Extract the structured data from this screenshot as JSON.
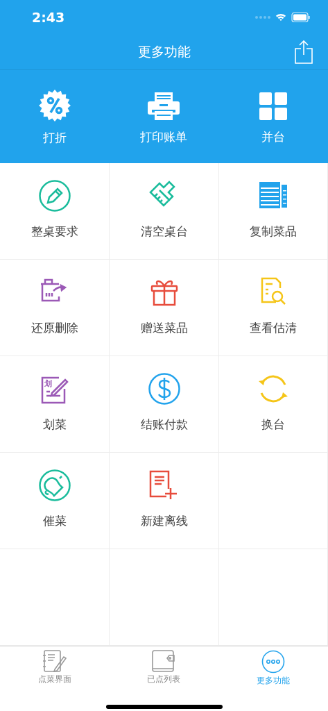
{
  "status_bar": {
    "time": "2:43"
  },
  "nav": {
    "title": "更多功能"
  },
  "quick_actions": [
    {
      "kind": "discount",
      "label": "打折"
    },
    {
      "kind": "printer",
      "label": "打印账单"
    },
    {
      "kind": "grid",
      "label": "并台"
    }
  ],
  "functions": [
    {
      "kind": "pencil",
      "label": "整桌要求",
      "color": "#1abc9c"
    },
    {
      "kind": "brush",
      "label": "清空桌台",
      "color": "#1abc9c"
    },
    {
      "kind": "copy",
      "label": "复制菜品",
      "color": "#22a3ec"
    },
    {
      "kind": "restore",
      "label": "还原删除",
      "color": "#9b59b6"
    },
    {
      "kind": "gift",
      "label": "赠送菜品",
      "color": "#e74c3c"
    },
    {
      "kind": "search-doc",
      "label": "查看估清",
      "color": "#f5c518"
    },
    {
      "kind": "mark",
      "label": "划菜",
      "color": "#9b59b6",
      "icon_text": "划"
    },
    {
      "kind": "dollar",
      "label": "结账付款",
      "color": "#22a3ec"
    },
    {
      "kind": "refresh",
      "label": "换台",
      "color": "#f5c518"
    },
    {
      "kind": "bell",
      "label": "催菜",
      "color": "#1abc9c"
    },
    {
      "kind": "new-doc",
      "label": "新建离线",
      "color": "#e74c3c"
    }
  ],
  "tab_bar": [
    {
      "kind": "notebook",
      "label": "点菜界面",
      "selected": false
    },
    {
      "kind": "wallet",
      "label": "已点列表",
      "selected": false
    },
    {
      "kind": "more",
      "label": "更多功能",
      "selected": true
    }
  ]
}
